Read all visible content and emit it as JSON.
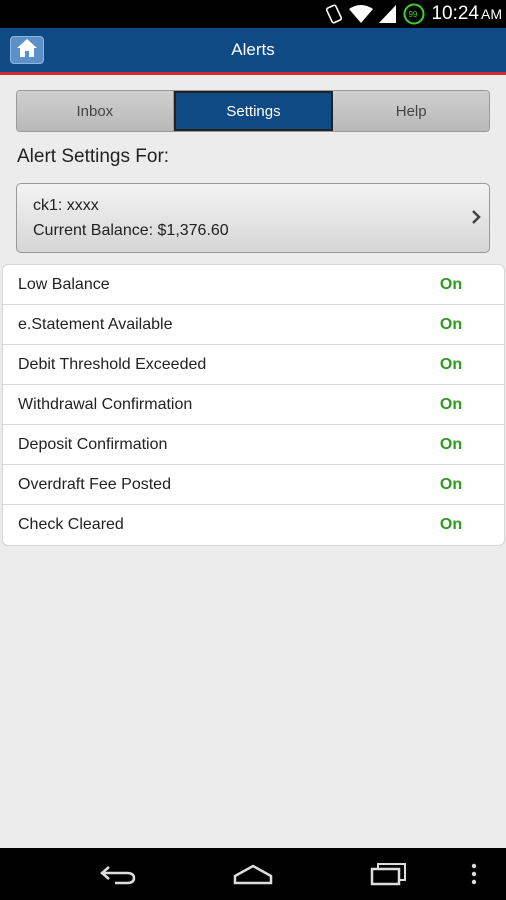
{
  "status_bar": {
    "time": "10:24",
    "ampm": "AM",
    "battery_level": "99",
    "icons": [
      "rotate-icon",
      "wifi-icon",
      "signal-icon",
      "battery-icon"
    ]
  },
  "header": {
    "title": "Alerts",
    "home_icon": "home-icon"
  },
  "tabs": [
    {
      "label": "Inbox",
      "active": false
    },
    {
      "label": "Settings",
      "active": true
    },
    {
      "label": "Help",
      "active": false
    }
  ],
  "section_label": "Alert Settings For:",
  "account": {
    "name": "ck1: xxxx",
    "balance_label": "Current Balance:",
    "balance_value": "$1,376.60"
  },
  "alerts": [
    {
      "name": "Low Balance",
      "status": "On"
    },
    {
      "name": "e.Statement Available",
      "status": "On"
    },
    {
      "name": "Debit Threshold Exceeded",
      "status": "On"
    },
    {
      "name": "Withdrawal Confirmation",
      "status": "On"
    },
    {
      "name": "Deposit Confirmation",
      "status": "On"
    },
    {
      "name": "Overdraft Fee Posted",
      "status": "On"
    },
    {
      "name": "Check Cleared",
      "status": "On"
    }
  ],
  "colors": {
    "header": "#0f4a85",
    "accent_red": "#d62b33",
    "status_on": "#2e9b1a"
  }
}
